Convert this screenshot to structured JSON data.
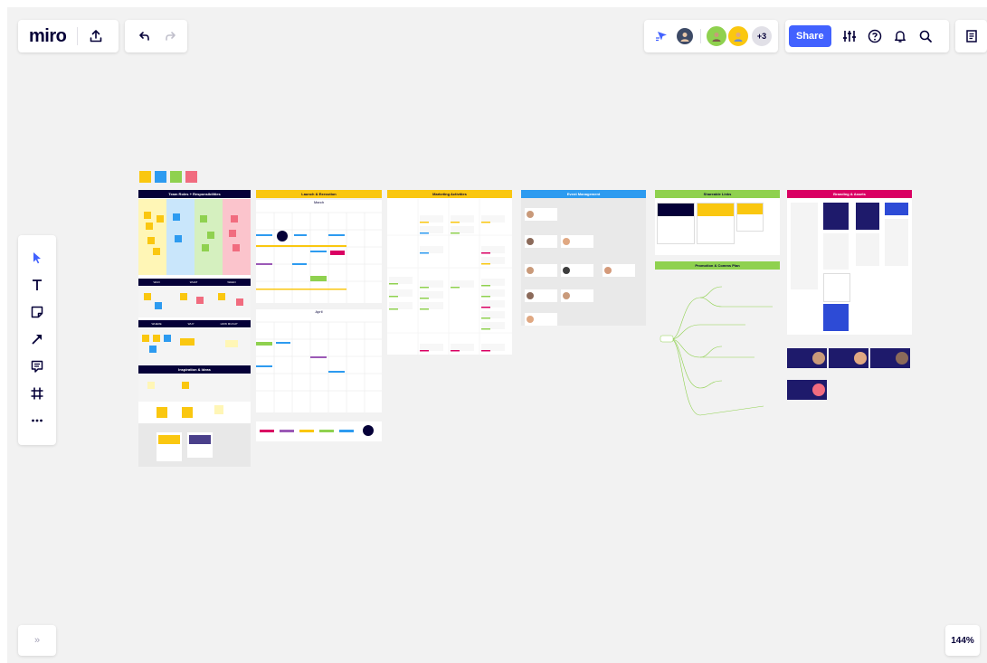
{
  "app": {
    "logo": "miro"
  },
  "toolbar": {
    "share_label": "Share",
    "collaborators_extra": "+3",
    "zoom_level": "144%",
    "expand_label": "»"
  },
  "colors": {
    "accent": "#4262ff",
    "yellow": "#fac710",
    "blue": "#2d9bf0",
    "green": "#8fd14f",
    "pink": "#da0063",
    "navy": "#050038"
  },
  "tools": [
    {
      "name": "select-icon"
    },
    {
      "name": "text-icon"
    },
    {
      "name": "sticky-note-icon"
    },
    {
      "name": "arrow-icon"
    },
    {
      "name": "comment-icon"
    },
    {
      "name": "frame-icon"
    },
    {
      "name": "more-icon"
    }
  ],
  "board": {
    "frames": [
      {
        "id": "team",
        "title": "Team Roles + Responsibilities",
        "color": "#050038",
        "textColor": "#ffffff"
      },
      {
        "id": "launch",
        "title": "Launch & Execution",
        "color": "#fac710",
        "textColor": "#050038"
      },
      {
        "id": "marketing",
        "title": "Marketing Activities",
        "color": "#fac710",
        "textColor": "#050038"
      },
      {
        "id": "event",
        "title": "Event Management",
        "color": "#2d9bf0",
        "textColor": "#ffffff"
      },
      {
        "id": "shareable",
        "title": "Shareable Links",
        "color": "#8fd14f",
        "textColor": "#050038"
      },
      {
        "id": "promotion",
        "title": "Promotion & Comms Plan",
        "color": "#8fd14f",
        "textColor": "#050038"
      },
      {
        "id": "branding",
        "title": "Branding & Assets",
        "color": "#da0063",
        "textColor": "#ffffff"
      },
      {
        "id": "inspiration",
        "title": "Inspiration & Ideas",
        "color": "#050038",
        "textColor": "#ffffff"
      }
    ],
    "calendar": {
      "month1": "March",
      "month2": "April"
    },
    "team_sections": {
      "who": "WHO",
      "what": "WHAT",
      "when": "WHEN",
      "where": "WHERE",
      "why": "WHY",
      "how": "HOW MUCH?"
    }
  }
}
